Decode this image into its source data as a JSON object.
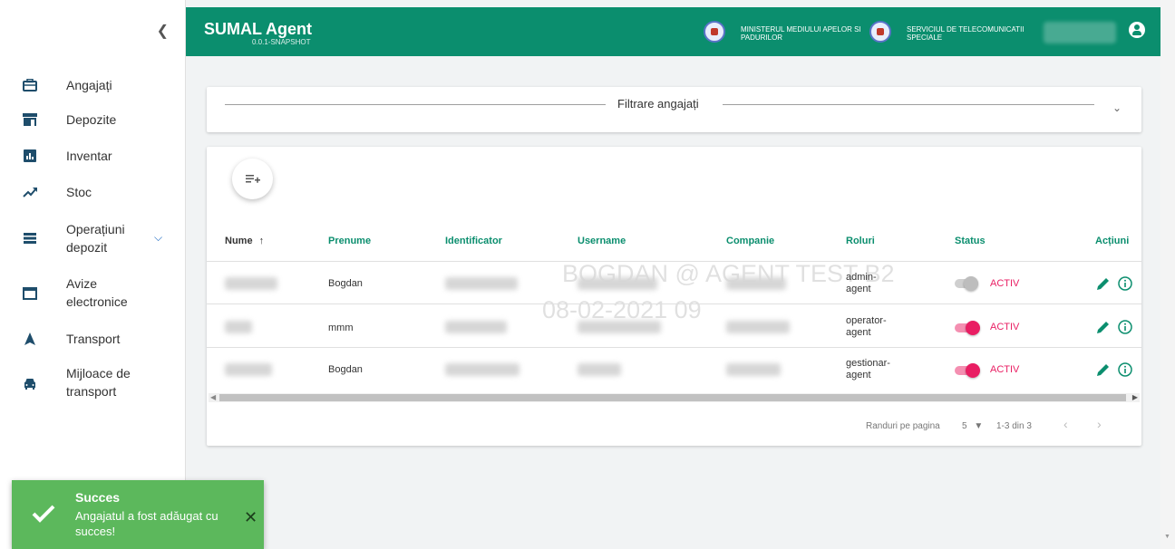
{
  "header": {
    "app_title": "SUMAL Agent",
    "app_version": "0.0.1-SNAPSHOT",
    "org1": "MINISTERUL MEDIULUI APELOR SI PADURILOR",
    "org2": "SERVICIUL DE TELECOMUNICATII SPECIALE",
    "accent_color": "#0b8e6e"
  },
  "sidebar": {
    "collapse_icon": "chevron-left-icon",
    "items": [
      {
        "label": "Angajați",
        "icon": "briefcase-icon"
      },
      {
        "label": "Depozite",
        "icon": "store-icon"
      },
      {
        "label": "Inventar",
        "icon": "bar-chart-icon"
      },
      {
        "label": "Stoc",
        "icon": "trending-up-icon"
      },
      {
        "label": "Operațiuni depozit",
        "icon": "list-icon"
      },
      {
        "label": "Avize electronice",
        "icon": "window-icon"
      },
      {
        "label": "Transport",
        "icon": "navigation-icon"
      },
      {
        "label": "Mijloace de transport",
        "icon": "car-icon"
      }
    ]
  },
  "filter": {
    "title": "Filtrare angajați"
  },
  "table": {
    "columns": [
      "Nume",
      "Prenume",
      "Identificator",
      "Username",
      "Companie",
      "Roluri",
      "Status",
      "Acțiuni"
    ],
    "sort_indicator": "↑",
    "rows": [
      {
        "prenume": "Bogdan",
        "rol": "admin-agent",
        "status": "ACTIV",
        "toggle_on": false
      },
      {
        "prenume": "mmm",
        "rol": "operator-agent",
        "status": "ACTIV",
        "toggle_on": true
      },
      {
        "prenume": "Bogdan",
        "rol": "gestionar-agent",
        "status": "ACTIV",
        "toggle_on": true
      }
    ],
    "watermark_line1": "BOGDAN @ AGENT TEST B2",
    "watermark_line2": "08-02-2021 09",
    "rows_per_page_label": "Randuri pe pagina",
    "rows_per_page": "5",
    "range_text": "1-3 din 3"
  },
  "toast": {
    "title": "Succes",
    "message": "Angajatul a fost adăugat cu succes!",
    "color": "#5cb85c"
  }
}
